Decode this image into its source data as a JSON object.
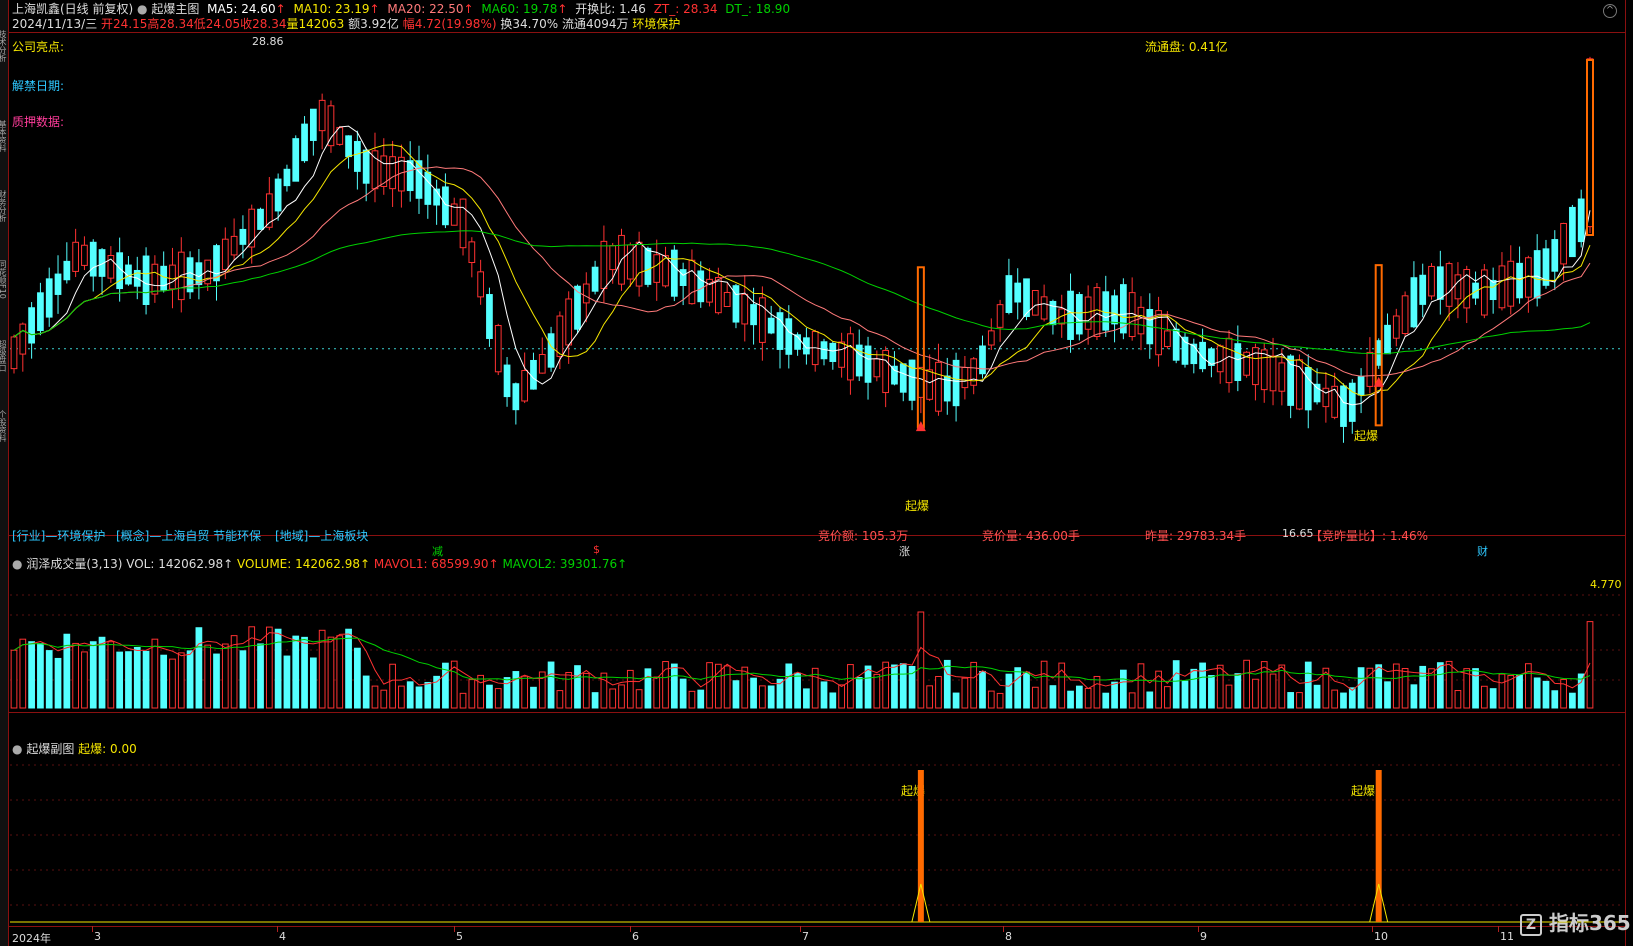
{
  "header": {
    "stock_name": "上海凯鑫(日线 前复权)",
    "main_chart_name": "起爆主图",
    "ma5": "MA5: 24.60",
    "ma10": "MA10: 23.19",
    "ma20": "MA20: 22.50",
    "ma60": "MA60: 19.78",
    "turnover_ratio": "开换比: 1.46",
    "zt": "ZT_: 28.34",
    "dt": "DT_: 18.90",
    "date": "2024/11/13/三",
    "open": "开24.15",
    "high": "高28.34",
    "low": "低24.05",
    "close": "收28.34",
    "volume": "量142063",
    "amount": "额3.92亿",
    "change": "幅4.72(19.98%)",
    "turnover": "换34.70%",
    "float_shares": "流通4094万",
    "concept": "环境保护"
  },
  "annotations": {
    "company_highlight": "公司亮点:",
    "unlock_date": "解禁日期:",
    "pledge_data": "质押数据:",
    "float_cap": "流通盘: 0.41亿",
    "high_label": "28.86",
    "low_label": "16.65",
    "industry": "[行业]—环境保护",
    "concept": "[概念]—上海自贸 节能环保",
    "region": "[地域]—上海板块",
    "bid_amount": "竞价额: 105.3万",
    "bid_volume": "竞价量: 436.00手",
    "yesterday_volume": "昨量: 29783.34手",
    "bid_yesterday_ratio": "【竞昨量比】: 1.46%",
    "signal_label": "起爆",
    "date_marks": [
      "减",
      "$",
      "涨",
      "财"
    ]
  },
  "volume_panel": {
    "name": "润泽成交量(3,13)",
    "vol": "VOL: 142062.98↑",
    "volume": "VOLUME: 142062.98↑",
    "mavol1": "MAVOL1: 68599.90↑",
    "mavol2": "MAVOL2: 39301.76↑",
    "max_label": "4.770"
  },
  "sub_panel": {
    "name": "起爆副图",
    "value": "起爆: 0.00",
    "signal_label": "起爆"
  },
  "x_axis": {
    "labels": [
      "2024年",
      "3",
      "4",
      "5",
      "6",
      "7",
      "8",
      "9",
      "10",
      "11"
    ]
  },
  "watermark": "指标365",
  "sidebar_tabs": [
    "技术分析",
    "基本资料",
    "财务分析",
    "同花顺F10",
    "超级盘口",
    "个股资料"
  ],
  "colors": {
    "up": "#ff3232",
    "down": "#54ffff",
    "ma5": "#ffffff",
    "ma10": "#f5e600",
    "ma20": "#ff7a7a",
    "ma60": "#00d000",
    "signal": "#ff6a00"
  },
  "chart_data": {
    "type": "candlestick",
    "title": "起爆主图",
    "ylim": [
      16.65,
      28.86
    ],
    "last_close": 28.34,
    "series_names": [
      "MA5",
      "MA10",
      "MA20",
      "MA60",
      "VOLUME",
      "MAVOL1",
      "MAVOL2",
      "起爆"
    ],
    "signal_days": [
      113,
      170
    ]
  }
}
